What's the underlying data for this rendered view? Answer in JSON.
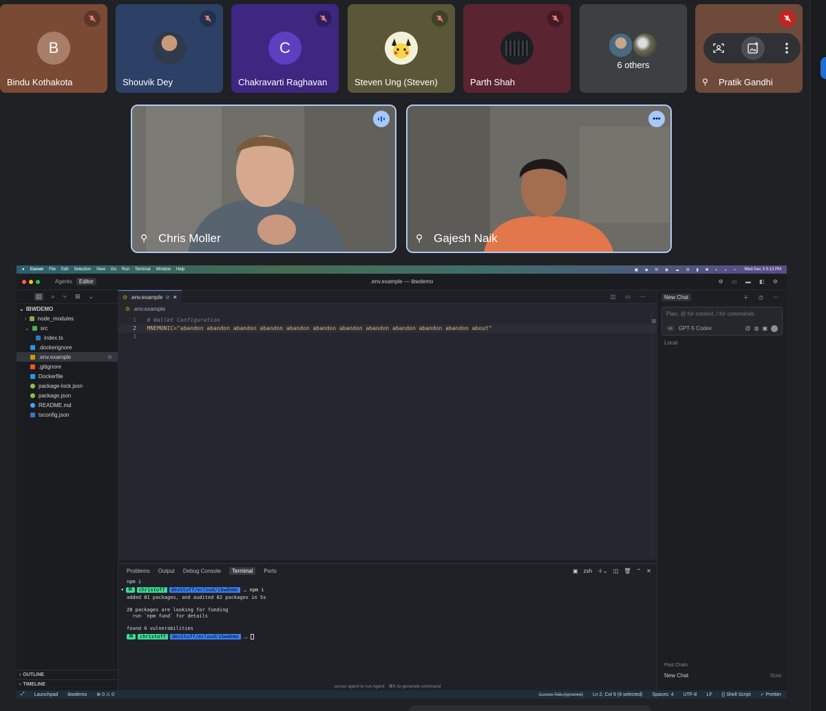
{
  "meet": {
    "participants": [
      {
        "name": "Bindu Kothakota",
        "initial": "B",
        "bg": "#7a4a34",
        "avatar_bg": "#a87e69"
      },
      {
        "name": "Shouvik Dey",
        "initial": "",
        "bg": "#2d4166",
        "avatar_bg": ""
      },
      {
        "name": "Chakravarti Raghavan",
        "initial": "C",
        "bg": "#3d2780",
        "avatar_bg": "#5e3fc2"
      },
      {
        "name": "Steven Ung (Steven)",
        "initial": "",
        "bg": "#5a5638",
        "avatar_bg": ""
      },
      {
        "name": "Parth Shah",
        "initial": "",
        "bg": "#5a2431",
        "avatar_bg": ""
      }
    ],
    "others_label": "6 others",
    "pinned_tile_name": "Pratik Gandhi",
    "speakers": [
      {
        "name": "Chris Moller"
      },
      {
        "name": "Gajesh Naik"
      }
    ],
    "colors": {
      "mute_red": "#c5221f",
      "speaker_border": "#aecbfa",
      "meet_bg": "#202124"
    },
    "icons": {
      "mute": "mic-off-icon",
      "pin": "pin-icon",
      "more": "more-vert-icon"
    }
  },
  "ide": {
    "menubar": {
      "app": "Cursor",
      "items": [
        "File",
        "Edit",
        "Selection",
        "View",
        "Go",
        "Run",
        "Terminal",
        "Window",
        "Help"
      ],
      "clock": "Wed Dec 3  9:13 PM"
    },
    "titlebar": {
      "tab_agents": "Agents",
      "tab_editor": "Editor",
      "title": ".env.example — ibwdemo"
    },
    "explorer": {
      "root": "IBWDEMO",
      "items": [
        {
          "label": "node_modules",
          "kind": "folder"
        },
        {
          "label": "src",
          "kind": "folder-open"
        },
        {
          "label": "index.ts",
          "kind": "ts"
        },
        {
          "label": ".dockerignore",
          "kind": "docker"
        },
        {
          "label": ".env.example",
          "kind": "env"
        },
        {
          "label": ".gitignore",
          "kind": "git"
        },
        {
          "label": "Dockerfile",
          "kind": "docker"
        },
        {
          "label": "package-lock.json",
          "kind": "npm"
        },
        {
          "label": "package.json",
          "kind": "npm"
        },
        {
          "label": "README.md",
          "kind": "info"
        },
        {
          "label": "tsconfig.json",
          "kind": "ts"
        }
      ],
      "outline": "OUTLINE",
      "timeline": "TIMELINE"
    },
    "editor": {
      "tab_label": ".env.example",
      "breadcrumb": ".env.example",
      "lines": [
        {
          "num": "1",
          "text": "  # Wallet Configuration"
        },
        {
          "num": "2",
          "text": "  MNEMONIC=\"abandon abandon abandon abandon abandon abandon abandon abandon abandon abandon abandon about\""
        },
        {
          "num": "3",
          "text": ""
        }
      ]
    },
    "panel": {
      "tabs": [
        "Problems",
        "Output",
        "Debug Console",
        "Terminal",
        "Ports"
      ],
      "active_tab": "Terminal",
      "shell": "zsh",
      "lines": [
        "npm i",
        "added 81 packages, and audited 82 packages in 5s",
        "",
        "28 packages are looking for funding",
        "  run `npm fund` for details",
        "",
        "found 0 vulnerabilities"
      ],
      "prompt_user": "christoff",
      "prompt_path": "devStuff/ecloud/ibwdemo",
      "prompt_cmd": "npm i",
      "hint": "cursor agent to run Agent · ⌘K to generate command"
    },
    "chat": {
      "tab": "New Chat",
      "placeholder": "Plan, @ for context, / for commands",
      "mode": "∞",
      "model": "GPT-5 Codex",
      "local": "Local",
      "past_chats": "Past Chats",
      "new_chat_item": "New Chat",
      "new_chat_time": "Now"
    },
    "status": {
      "items": [
        "Launchpad",
        "ibwdemo",
        "⊗ 0 ⚠ 0"
      ],
      "right": [
        "Cursor Tab (Ignored)",
        "Ln 2, Col 9 (8 selected)",
        "Spaces: 4",
        "UTF-8",
        "LF",
        "{} Shell Script",
        "✓ Prettier"
      ]
    }
  }
}
